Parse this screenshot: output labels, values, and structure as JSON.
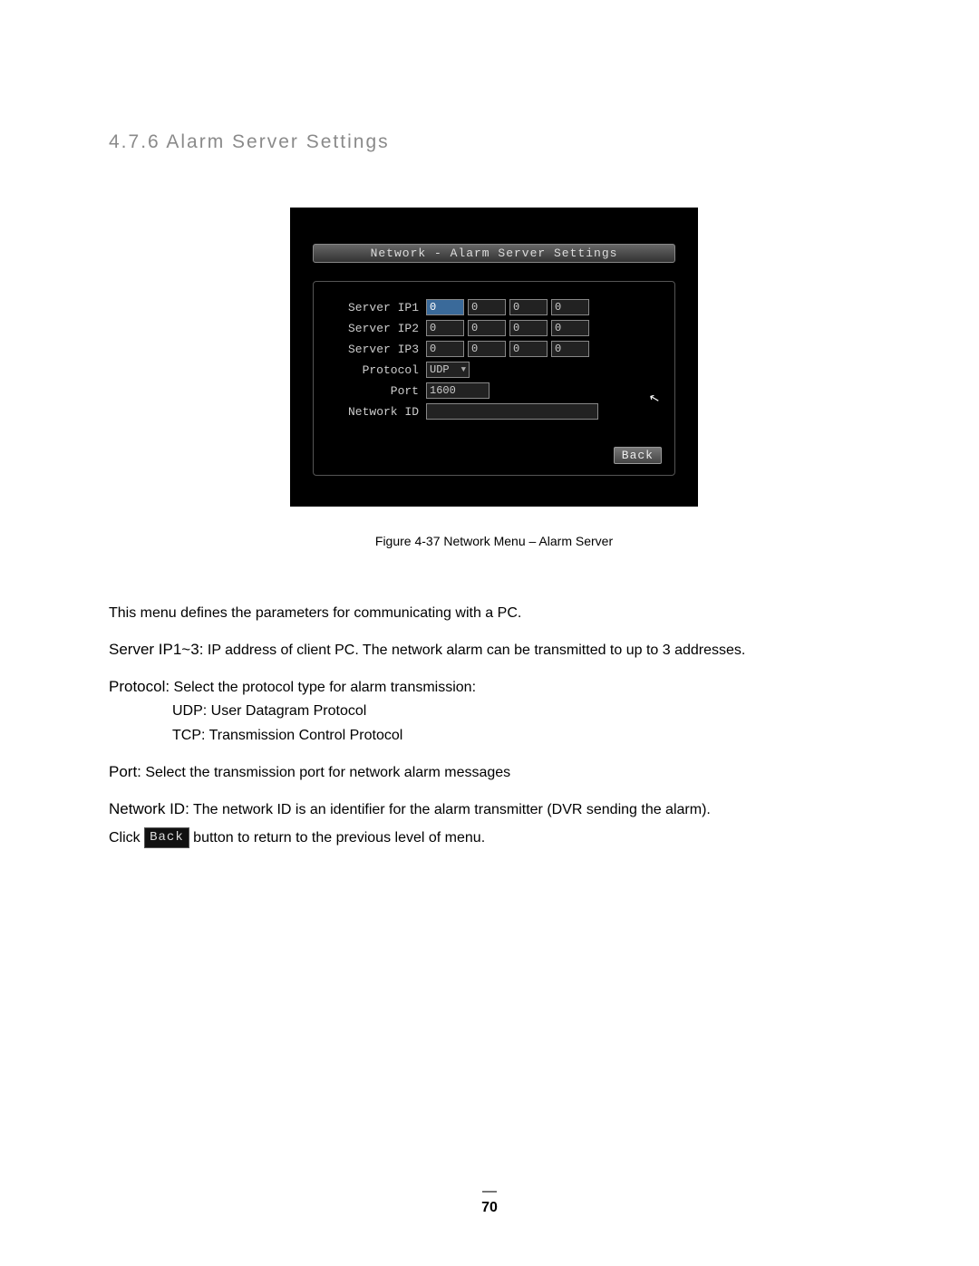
{
  "heading": "4.7.6  Alarm Server Settings",
  "screenshot": {
    "title": "Network - Alarm Server Settings",
    "rows": {
      "ip1": {
        "label": "Server IP1",
        "vals": [
          "0",
          "0",
          "0",
          "0"
        ]
      },
      "ip2": {
        "label": "Server IP2",
        "vals": [
          "0",
          "0",
          "0",
          "0"
        ]
      },
      "ip3": {
        "label": "Server IP3",
        "vals": [
          "0",
          "0",
          "0",
          "0"
        ]
      },
      "protocol": {
        "label": "Protocol",
        "value": "UDP"
      },
      "port": {
        "label": "Port",
        "value": "1600"
      },
      "netid": {
        "label": "Network ID",
        "value": ""
      }
    },
    "back": "Back"
  },
  "caption": "Figure 4-37  Network Menu – Alarm Server",
  "body": {
    "intro": "This menu defines the parameters for communicating with a PC.",
    "server_ip_label": "Server IP1~3:",
    "server_ip_text": " IP address of client PC. The network alarm can be transmitted to up to 3 addresses.",
    "protocol_label": "Protocol:",
    "protocol_text": " Select the protocol type for alarm transmission:",
    "protocol_udp": "UDP: User Datagram Protocol",
    "protocol_tcp": "TCP: Transmission Control Protocol",
    "port_label": "Port:",
    "port_text": " Select the transmission port for network alarm messages",
    "netid_label": "Network ID:",
    "netid_text": " The network ID is an identifier for the alarm transmitter (DVR sending the alarm).",
    "click_prefix": "Click ",
    "inline_back": "Back",
    "click_suffix": " button to return to the previous level of menu."
  },
  "page_number": "70"
}
